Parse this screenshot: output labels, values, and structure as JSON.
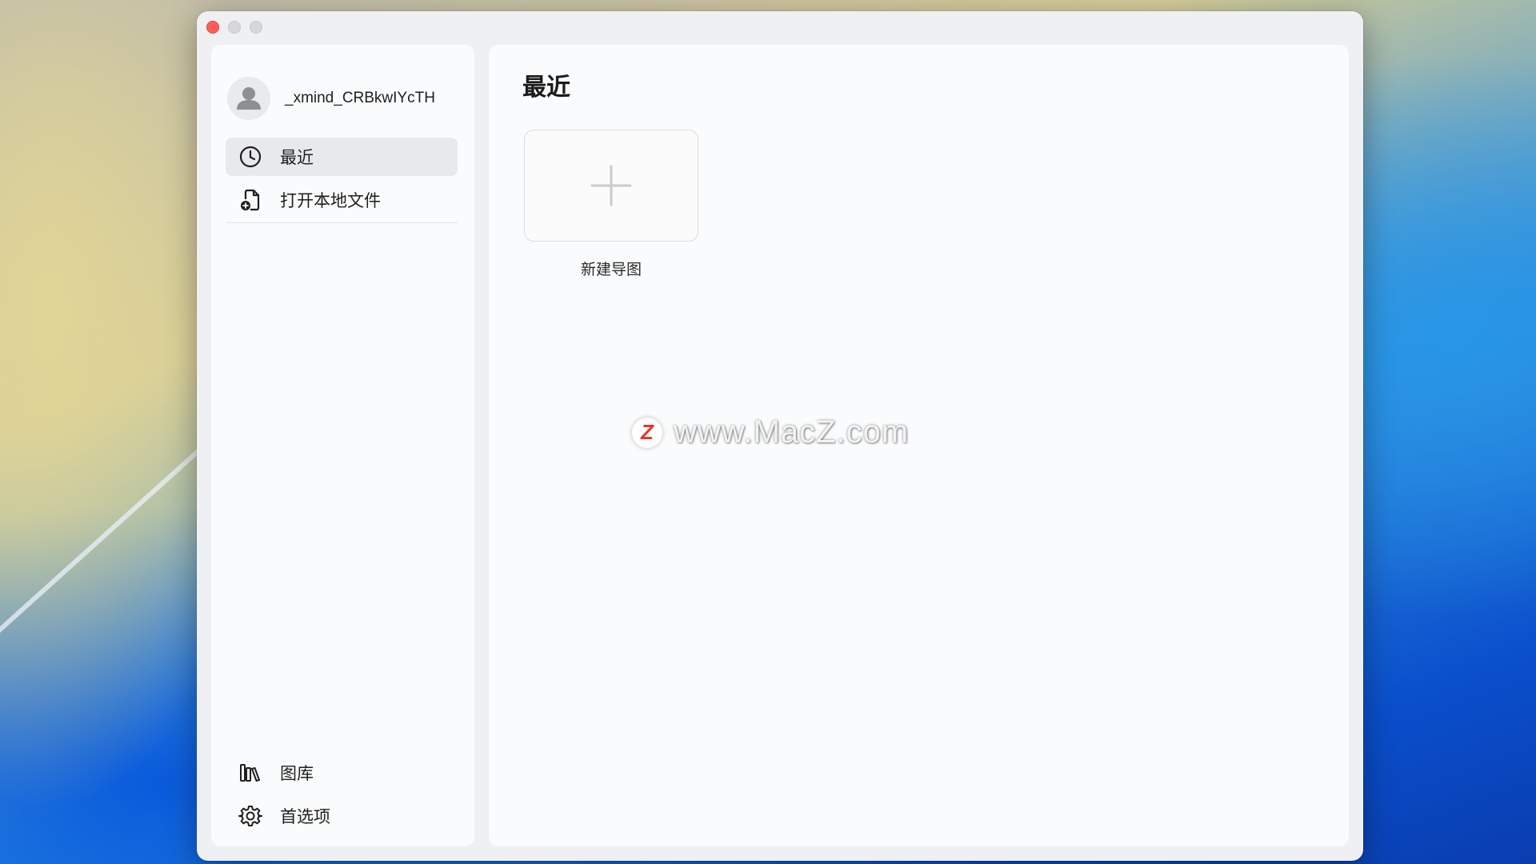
{
  "window": {
    "controls": [
      "close",
      "minimize",
      "maximize"
    ]
  },
  "sidebar": {
    "user": {
      "name": "_xmind_CRBkwIYcTH",
      "avatar_icon": "person-icon"
    },
    "items": [
      {
        "label": "最近",
        "icon": "clock-icon",
        "active": true
      },
      {
        "label": "打开本地文件",
        "icon": "open-file-icon",
        "active": false
      }
    ],
    "bottom_items": [
      {
        "label": "图库",
        "icon": "library-icon"
      },
      {
        "label": "首选项",
        "icon": "gear-icon"
      }
    ]
  },
  "main": {
    "title": "最近",
    "new_card": {
      "label": "新建导图",
      "icon": "plus-icon"
    }
  },
  "watermark": {
    "logo_letter": "Z",
    "text": "www.MacZ.com"
  },
  "colors": {
    "close": "#ff5f57",
    "active_item_bg": "#e8e9ec",
    "watermark_logo": "#e8332a"
  }
}
